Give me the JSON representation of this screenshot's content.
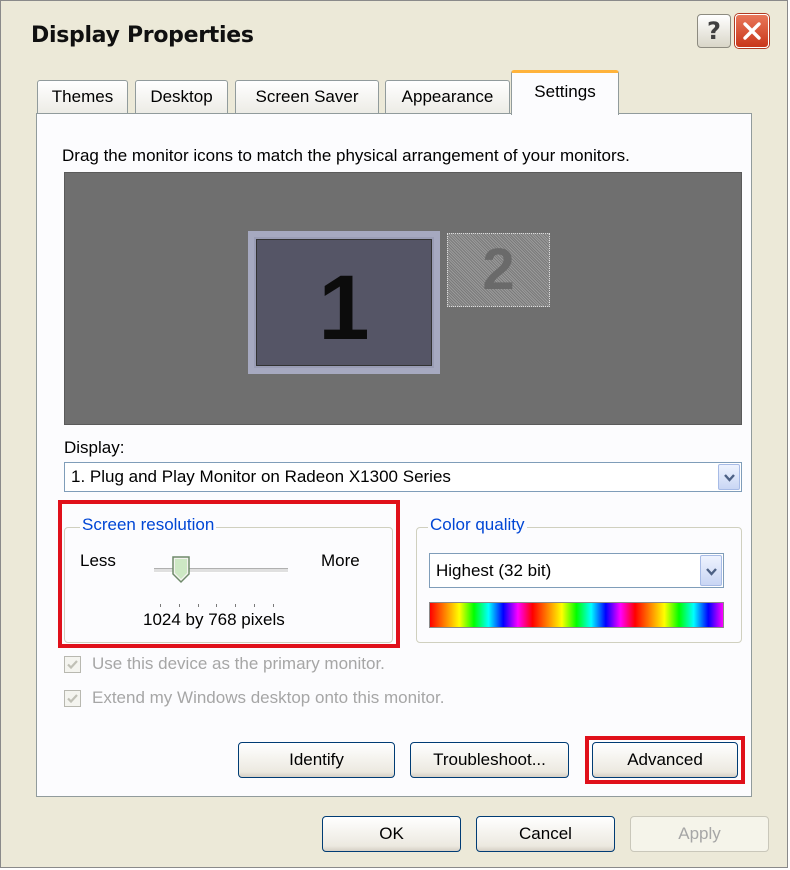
{
  "window": {
    "title": "Display Properties",
    "help_glyph": "?",
    "close_icon": "close-icon"
  },
  "tabs": [
    {
      "label": "Themes"
    },
    {
      "label": "Desktop"
    },
    {
      "label": "Screen Saver"
    },
    {
      "label": "Appearance"
    },
    {
      "label": "Settings",
      "active": true
    }
  ],
  "settings": {
    "instruction": "Drag the monitor icons to match the physical arrangement of your monitors.",
    "monitors": [
      {
        "number": "1",
        "active": true
      },
      {
        "number": "2",
        "active": false
      }
    ],
    "display_label": "Display:",
    "display_value": "1. Plug and Play Monitor on Radeon X1300 Series",
    "screen_resolution": {
      "title": "Screen resolution",
      "less_label": "Less",
      "more_label": "More",
      "value_text": "1024 by 768 pixels",
      "slider_level": 0.2
    },
    "color_quality": {
      "title": "Color quality",
      "value": "Highest (32 bit)"
    },
    "checkboxes": [
      {
        "label": "Use this device as the primary monitor.",
        "checked": true,
        "enabled": false
      },
      {
        "label": "Extend my Windows desktop onto this monitor.",
        "checked": true,
        "enabled": false
      }
    ],
    "buttons": {
      "identify": "Identify",
      "troubleshoot": "Troubleshoot...",
      "advanced": "Advanced"
    }
  },
  "footer": {
    "ok": "OK",
    "cancel": "Cancel",
    "apply": "Apply"
  },
  "colors": {
    "highlight_box": "#e0101a",
    "group_title": "#0046d5",
    "tab_accent": "#ffb33b"
  }
}
